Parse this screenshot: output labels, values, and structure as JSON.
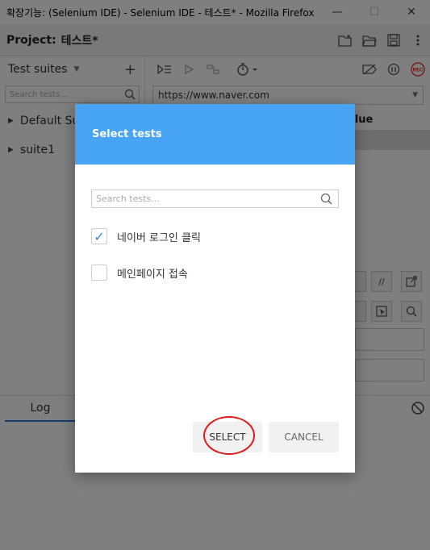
{
  "window": {
    "title": "확장기능: (Selenium IDE) - Selenium IDE - 테스트* - Mozilla Firefox",
    "minimize": "—",
    "maximize": "☐",
    "close": "✕"
  },
  "project": {
    "label": "Project:",
    "name": "테스트*"
  },
  "left_panel": {
    "header": "Test suites",
    "add": "+",
    "search_placeholder": "Search tests...",
    "suites": [
      {
        "label": "Default Sui"
      },
      {
        "label": "suite1"
      }
    ]
  },
  "editor": {
    "url": "https://www.naver.com",
    "column_value": "alue"
  },
  "bottom": {
    "log_tab": "Log"
  },
  "dialog": {
    "title": "Select tests",
    "search_placeholder": "Search tests...",
    "tests": [
      {
        "label": "네이버 로그인 클릭",
        "checked": true,
        "check_glyph": "✓"
      },
      {
        "label": "메인페이지 접속",
        "checked": false,
        "check_glyph": ""
      }
    ],
    "select_label": "SELECT",
    "cancel_label": "CANCEL"
  },
  "colors": {
    "dialog_header": "#47a3f3",
    "checkmark": "#2a8cf0",
    "highlight_ring": "#e01a1a",
    "rec": "#d22"
  }
}
